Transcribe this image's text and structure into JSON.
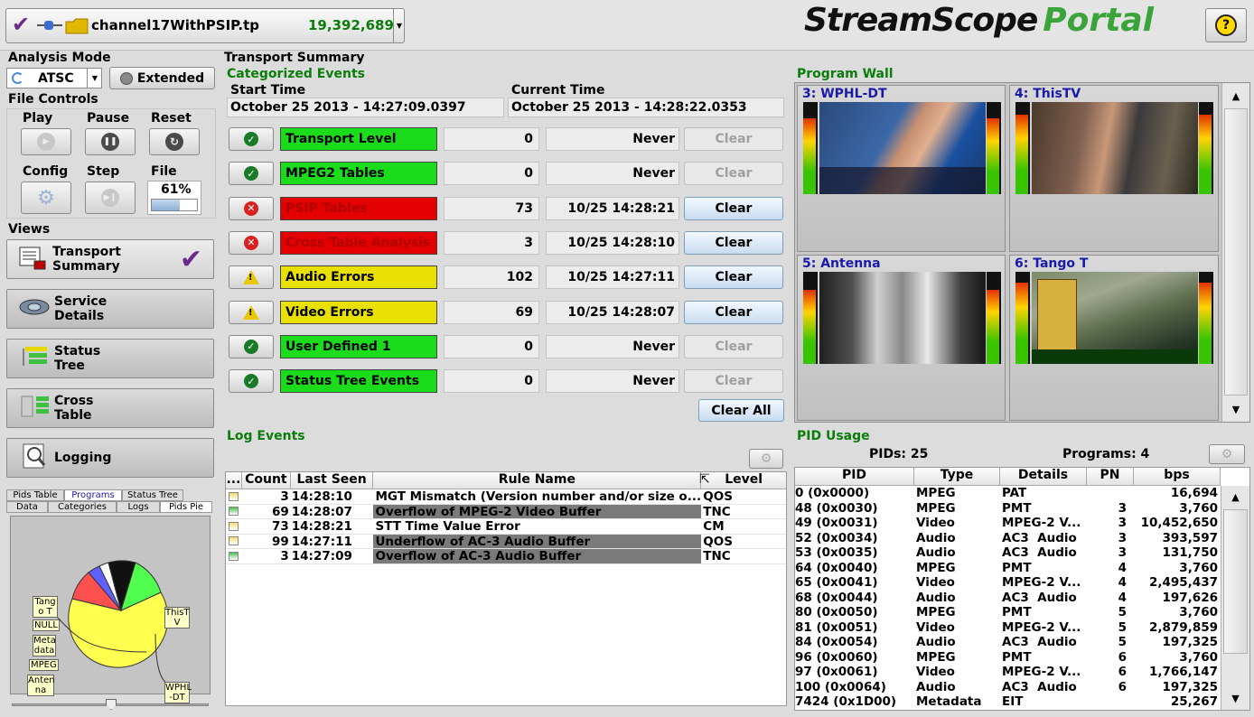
{
  "header": {
    "file_name": "channel17WithPSIP.tp",
    "packet_count": "19,392,689",
    "logo_stream": "StreamScope",
    "logo_portal": "Portal",
    "help_label": "?"
  },
  "analysis_mode": {
    "title": "Analysis Mode",
    "mode_value": "ATSC",
    "extended_label": "Extended"
  },
  "file_controls": {
    "title": "File Controls",
    "play": "Play",
    "pause": "Pause",
    "reset": "Reset",
    "config": "Config",
    "step": "Step",
    "file": "File",
    "file_progress_label": "61%",
    "file_progress": 0.61
  },
  "views": {
    "title": "Views",
    "items": [
      {
        "line1": "Transport",
        "line2": "Summary"
      },
      {
        "line1": "Service",
        "line2": "Details"
      },
      {
        "line1": "Status",
        "line2": "Tree"
      },
      {
        "line1": "Cross",
        "line2": "Table"
      },
      {
        "line1": "Logging",
        "line2": ""
      }
    ]
  },
  "mini_tabs": {
    "row1": [
      "Pids Table",
      "Programs",
      "Status Tree"
    ],
    "row2": [
      "Data",
      "Categories",
      "Logs",
      "Pids Pie"
    ]
  },
  "pie": {
    "labels": [
      "Tang o T",
      "NULL",
      "Meta data",
      "MPEG",
      "Anten na",
      "ThisT V",
      "WPHL -DT"
    ]
  },
  "transport_summary": {
    "title": "Transport Summary",
    "categorized_title": "Categorized Events",
    "start_time_label": "Start Time",
    "start_time": "October 25 2013 - 14:27:09.0397",
    "current_time_label": "Current Time",
    "current_time": "October 25 2013 - 14:28:22.0353",
    "events": [
      {
        "status": "ok",
        "label": "Transport Level",
        "color": "#1bdc1b",
        "text_color": "#000000",
        "count": "0",
        "last": "Never",
        "clear": "Clear",
        "clear_enabled": false
      },
      {
        "status": "ok",
        "label": "MPEG2 Tables",
        "color": "#1bdc1b",
        "text_color": "#000000",
        "count": "0",
        "last": "Never",
        "clear": "Clear",
        "clear_enabled": false
      },
      {
        "status": "err",
        "label": "PSIP Tables",
        "color": "#e40000",
        "text_color": "#b00000",
        "count": "73",
        "last": "10/25 14:28:21",
        "clear": "Clear",
        "clear_enabled": true
      },
      {
        "status": "err",
        "label": "Cross Table Analysis",
        "color": "#e40000",
        "text_color": "#b00000",
        "count": "3",
        "last": "10/25 14:28:10",
        "clear": "Clear",
        "clear_enabled": true
      },
      {
        "status": "warn",
        "label": "Audio Errors",
        "color": "#e8e000",
        "text_color": "#000000",
        "count": "102",
        "last": "10/25 14:27:11",
        "clear": "Clear",
        "clear_enabled": true
      },
      {
        "status": "warn",
        "label": "Video Errors",
        "color": "#e8e000",
        "text_color": "#000000",
        "count": "69",
        "last": "10/25 14:28:07",
        "clear": "Clear",
        "clear_enabled": true
      },
      {
        "status": "ok",
        "label": "User Defined 1",
        "color": "#1bdc1b",
        "text_color": "#000000",
        "count": "0",
        "last": "Never",
        "clear": "Clear",
        "clear_enabled": false
      },
      {
        "status": "ok",
        "label": "Status Tree Events",
        "color": "#1bdc1b",
        "text_color": "#000000",
        "count": "0",
        "last": "Never",
        "clear": "Clear",
        "clear_enabled": false
      }
    ],
    "clear_all": "Clear All"
  },
  "program_wall": {
    "title": "Program Wall",
    "tiles": [
      {
        "title": "3: WPHL-DT"
      },
      {
        "title": "4: ThisTV"
      },
      {
        "title": "5: Antenna"
      },
      {
        "title": "6: Tango T"
      }
    ]
  },
  "log_events": {
    "title": "Log Events",
    "columns": [
      "...",
      "Count",
      "Last Seen",
      "Rule Name",
      "Level"
    ],
    "rows": [
      {
        "indicator": "#f0e070",
        "count": "3",
        "last_seen": "14:28:10",
        "rule": "MGT Mismatch (Version number and/or size o...",
        "level": "QOS",
        "highlight": false
      },
      {
        "indicator": "#50c050",
        "count": "69",
        "last_seen": "14:28:07",
        "rule": "Overflow of MPEG-2 Video Buffer",
        "level": "TNC",
        "highlight": true
      },
      {
        "indicator": "#f0e070",
        "count": "73",
        "last_seen": "14:28:21",
        "rule": "STT Time Value Error",
        "level": "CM",
        "highlight": false
      },
      {
        "indicator": "#f0e070",
        "count": "99",
        "last_seen": "14:27:11",
        "rule": "Underflow of AC-3 Audio Buffer",
        "level": "QOS",
        "highlight": true
      },
      {
        "indicator": "#50c050",
        "count": "3",
        "last_seen": "14:27:09",
        "rule": "Overflow of AC-3 Audio Buffer",
        "level": "TNC",
        "highlight": true
      }
    ]
  },
  "pid_usage": {
    "title": "PID Usage",
    "pids_label": "PIDs: 25",
    "programs_label": "Programs: 4",
    "columns": [
      "PID",
      "Type",
      "Details",
      "PN",
      "bps"
    ],
    "rows": [
      {
        "pid": "0 (0x0000)",
        "type": "MPEG",
        "details": "PAT",
        "pn": "",
        "bps": "16,694"
      },
      {
        "pid": "48 (0x0030)",
        "type": "MPEG",
        "details": "PMT",
        "pn": "3",
        "bps": "3,760"
      },
      {
        "pid": "49 (0x0031)",
        "type": "Video",
        "details": "MPEG-2 V...",
        "pn": "3",
        "bps": "10,452,650"
      },
      {
        "pid": "52 (0x0034)",
        "type": "Audio",
        "details": "AC3  Audio",
        "pn": "3",
        "bps": "393,597"
      },
      {
        "pid": "53 (0x0035)",
        "type": "Audio",
        "details": "AC3  Audio",
        "pn": "3",
        "bps": "131,750"
      },
      {
        "pid": "64 (0x0040)",
        "type": "MPEG",
        "details": "PMT",
        "pn": "4",
        "bps": "3,760"
      },
      {
        "pid": "65 (0x0041)",
        "type": "Video",
        "details": "MPEG-2 V...",
        "pn": "4",
        "bps": "2,495,437"
      },
      {
        "pid": "68 (0x0044)",
        "type": "Audio",
        "details": "AC3  Audio",
        "pn": "4",
        "bps": "197,626"
      },
      {
        "pid": "80 (0x0050)",
        "type": "MPEG",
        "details": "PMT",
        "pn": "5",
        "bps": "3,760"
      },
      {
        "pid": "81 (0x0051)",
        "type": "Video",
        "details": "MPEG-2 V...",
        "pn": "5",
        "bps": "2,879,859"
      },
      {
        "pid": "84 (0x0054)",
        "type": "Audio",
        "details": "AC3  Audio",
        "pn": "5",
        "bps": "197,325"
      },
      {
        "pid": "96 (0x0060)",
        "type": "MPEG",
        "details": "PMT",
        "pn": "6",
        "bps": "3,760"
      },
      {
        "pid": "97 (0x0061)",
        "type": "Video",
        "details": "MPEG-2 V...",
        "pn": "6",
        "bps": "1,766,147"
      },
      {
        "pid": "100 (0x0064)",
        "type": "Audio",
        "details": "AC3  Audio",
        "pn": "6",
        "bps": "197,325"
      },
      {
        "pid": "7424 (0x1D00)",
        "type": "Metadata",
        "details": "EIT",
        "pn": "",
        "bps": "25,267"
      }
    ]
  },
  "colors": {
    "accent_green": "#0a7d0a",
    "tile_title_blue": "#1a1aa8",
    "ok": "#1b7a2a",
    "error": "#d92020",
    "warning": "#e8c800"
  }
}
